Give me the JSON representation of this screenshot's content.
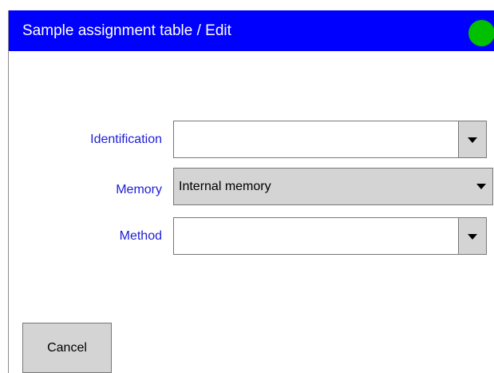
{
  "window": {
    "title": "Sample assignment table / Edit",
    "status_color": "#00c000",
    "title_bar_color": "#0000ff"
  },
  "form": {
    "identification": {
      "label": "Identification",
      "value": ""
    },
    "memory": {
      "label": "Memory",
      "value": "Internal memory"
    },
    "method": {
      "label": "Method",
      "value": ""
    }
  },
  "buttons": {
    "cancel": "Cancel"
  },
  "icons": {
    "dropdown": "caret-down-icon",
    "status": "status-indicator"
  }
}
